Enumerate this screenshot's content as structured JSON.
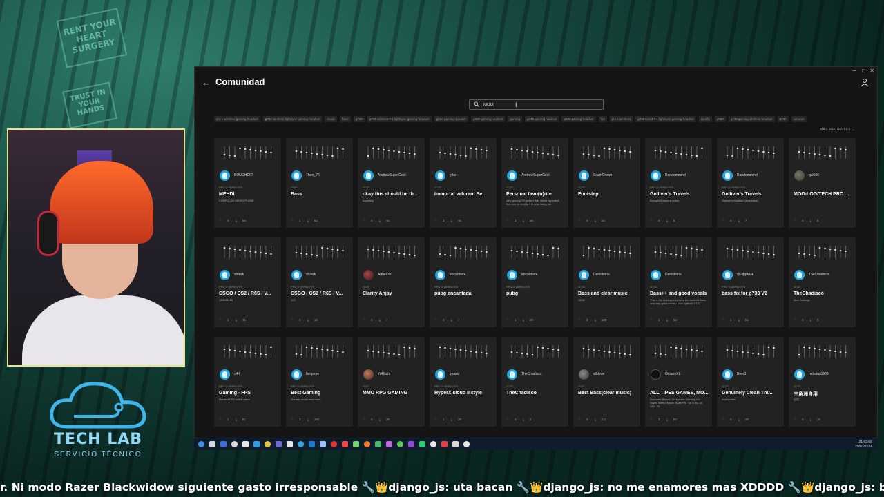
{
  "window": {
    "title": "Comunidad",
    "sort_label": "MÁS RECIENTES"
  },
  "search": {
    "value": "MOO|"
  },
  "tags": [
    "pro x wireless gaming headset",
    "g733 wireless lightsync gaming headset",
    "music",
    "bass",
    "g733",
    "g735 wireless 7.1 lightsync gaming headset",
    "g560 gaming speaker",
    "g432 gaming headset",
    "gaming",
    "g635 gaming headset",
    "g633 gaming headset",
    "fps",
    "pro x wireless",
    "g935 wired 7.1 lightsync gaming headset",
    "spotify",
    "g560",
    "g732 gaming wireless headset",
    "g735",
    "valorant"
  ],
  "cards": [
    {
      "author": "BOUGHDIR",
      "device": "PRO X WIRELESS",
      "name": "MEHDI",
      "desc": "CONFIG DE MEHDI PLUNE",
      "likes": "0",
      "downloads": "56"
    },
    {
      "author": "Theo_76",
      "device": "G560",
      "name": "Bass",
      "desc": "",
      "likes": "1",
      "downloads": "83"
    },
    {
      "author": "AndrewSuperCool",
      "device": "G733",
      "name": "okay this should be th...",
      "desc": "hopefully",
      "likes": "0",
      "downloads": "40"
    },
    {
      "author": "yrkz",
      "device": "G733",
      "name": "Immortal valorant Se...",
      "desc": "",
      "likes": "3",
      "downloads": "46"
    },
    {
      "author": "AndrewSuperCool",
      "device": "G733",
      "name": "Personal favo(u)rite",
      "desc": "very good g733 preset that i think is perfect, feel free to modify it to your liking tho",
      "likes": "3",
      "downloads": "58"
    },
    {
      "author": "ScamCrown",
      "device": "G733",
      "name": "Footstep",
      "desc": "",
      "likes": "0",
      "downloads": "24"
    },
    {
      "author": "Randommind",
      "device": "PRO X WIRELESS",
      "name": "Gulliver's Travels",
      "desc": "Brought it down a notch",
      "likes": "0",
      "downloads": "5"
    },
    {
      "author": "Randommind",
      "device": "PRO X WIRELESS",
      "name": "Gulliver's Travels",
      "desc": "Gulliver's Modified (less bass)",
      "likes": "0",
      "downloads": "7"
    },
    {
      "author": "gui666",
      "device": "",
      "name": "MOO-LOGITECH PRO ...",
      "desc": "",
      "likes": "0",
      "downloads": "5"
    },
    {
      "author": "shawk",
      "device": "PRO X WIRELESS",
      "name": "CSGO / CS2 / R6S / V...",
      "desc": "123123123",
      "likes": "1",
      "downloads": "41"
    },
    {
      "author": "shawk",
      "device": "PRO X WIRELESS",
      "name": "CSGO / CS2 / R6S / V...",
      "desc": "123",
      "likes": "0",
      "downloads": "15"
    },
    {
      "author": "Adhel090",
      "device": "G435",
      "name": "Clarity Anjay",
      "desc": "",
      "likes": "0",
      "downloads": "7"
    },
    {
      "author": "encantada",
      "device": "PRO X WIRELESS",
      "name": "pubg encantada",
      "desc": "",
      "likes": "0",
      "downloads": "7"
    },
    {
      "author": "encantada",
      "device": "PRO X WIRELESS",
      "name": "pubg",
      "desc": "",
      "likes": "1",
      "downloads": "28"
    },
    {
      "author": "Danisteinn",
      "device": "G733",
      "name": "Bass and clear music",
      "desc": "G635",
      "likes": "3",
      "downloads": "138"
    },
    {
      "author": "Danisteinn",
      "device": "G733",
      "name": "Bass++ and good vocals",
      "desc": "This is the best spot to have the beefiest bass and very good vocals. Via Logitech G733",
      "likes": "1",
      "downloads": "62"
    },
    {
      "author": "фыфрмыв",
      "device": "PRO X WIRELESS",
      "name": "bass fix for g733 V2",
      "desc": "",
      "likes": "1",
      "downloads": "51"
    },
    {
      "author": "TheChadisco",
      "device": "G733",
      "name": "TheChadisco",
      "desc": "New Settings",
      "likes": "0",
      "downloads": "6"
    },
    {
      "author": "c4rf",
      "device": "PRO X WIRELESS",
      "name": "Gaming - FPS",
      "desc": "Hardest FPS in this place",
      "likes": "1",
      "downloads": "81"
    },
    {
      "author": "lampepe",
      "device": "PRO X WIRELESS",
      "name": "Best Gaming",
      "desc": "Games, music and more",
      "likes": "3",
      "downloads": "184"
    },
    {
      "author": "YoRitch",
      "device": "G432",
      "name": "MMO RPG GAMING",
      "desc": "",
      "likes": "0",
      "downloads": "38"
    },
    {
      "author": "yoaskl",
      "device": "PRO X WIRELESS",
      "name": "HyperX cloud II style",
      "desc": "",
      "likes": "1",
      "downloads": "28"
    },
    {
      "author": "TheChadisco",
      "device": "G733",
      "name": "TheChadisco",
      "desc": "",
      "likes": "0",
      "downloads": "1"
    },
    {
      "author": "alldone",
      "device": "G432",
      "name": "Best Bass(clear music)",
      "desc": "",
      "likes": "0",
      "downloads": "110"
    },
    {
      "author": "OctaneXL",
      "device": "",
      "name": "ALL TIPES GAMES, MO...",
      "desc": "Surround Sound: On Modes: Gaming OG Super Stereo Mode: Base FS: 78 76 64 16 1231 78",
      "likes": "3",
      "downloads": "93"
    },
    {
      "author": "Beer3",
      "device": "G733",
      "name": "Genuinely Clean Thu...",
      "desc": "Audiophilla",
      "likes": "0",
      "downloads": "48"
    },
    {
      "author": "nebulus0906",
      "device": "G733",
      "name": "三角洲自用",
      "desc": "自用",
      "likes": "0",
      "downloads": "16"
    }
  ],
  "avatars": [
    "user",
    "user",
    "user",
    "user",
    "user",
    "user",
    "user",
    "user",
    "img1",
    "user",
    "user",
    "img2",
    "user",
    "user",
    "user",
    "user",
    "user",
    "user",
    "user",
    "user",
    "img3",
    "user",
    "user",
    "img4",
    "img5",
    "user",
    "user"
  ],
  "taskbar": {
    "time": "21:02:55",
    "date": "20/03/2024"
  },
  "ticker": "r. Ni modo Razer Blackwidow siguiente gasto irresponsable 🔧👑django_js: uta bacan 🔧👑django_js: no me enamores mas XDDDD 🔧👑django_js: belleza",
  "logo": {
    "brand": "TECH LAB",
    "sub": "SERVICIO TÉCNICO"
  },
  "bg_signs": [
    "RENT YOUR HEART SURGERY",
    "TRUST IN YOUR HANDS"
  ],
  "colors": {
    "accent": "#23a7e0",
    "window_bg": "#151515",
    "card_bg": "#222222",
    "cam_border": "#e8e58a"
  }
}
